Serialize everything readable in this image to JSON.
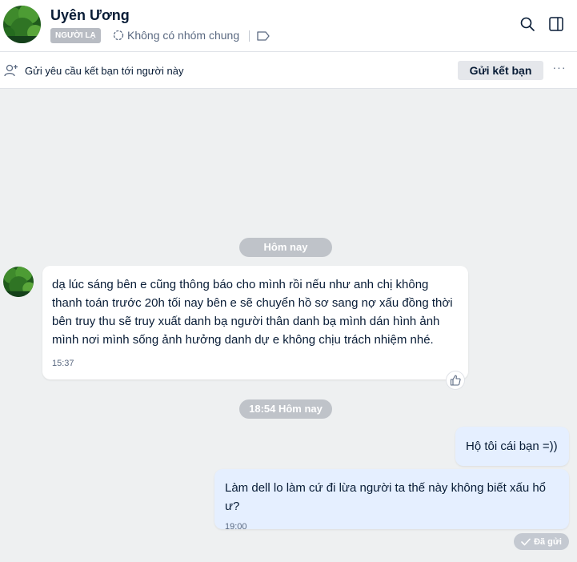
{
  "header": {
    "name": "Uyên Ương",
    "badge": "NGƯỜI LẠ",
    "common_groups": "Không có nhóm chung"
  },
  "friend_bar": {
    "text": "Gửi yêu cầu kết bạn tới người này",
    "button": "Gửi kết bạn",
    "more": "···"
  },
  "chat": {
    "date_separators": [
      "Hôm nay",
      "18:54 Hôm nay"
    ],
    "messages": [
      {
        "direction": "incoming",
        "text": "dạ lúc sáng bên e cũng thông báo cho mình rồi nếu như anh chị không thanh toán trước 20h tối nay bên e sẽ chuyển hồ sơ sang nợ xấu đồng thời bên truy thu sẽ truy xuất danh bạ người thân danh bạ mình dán hình ảnh mình nơi mình sống ảnh hưởng danh dự e không chịu trách nhiệm nhé.",
        "time": "15:37"
      },
      {
        "direction": "outgoing",
        "text": "Hộ tôi cái bạn =))"
      },
      {
        "direction": "outgoing",
        "text": "Làm dell lo làm cứ đi lừa người ta thế này không biết xấu hổ ư?",
        "time": "19:00"
      }
    ],
    "status": "Đã gửi"
  },
  "icons": {
    "header_search": "search-icon",
    "header_panel": "sidebar-toggle-icon",
    "add_friend": "add-user-icon",
    "groups": "group-circle-icon",
    "tag": "tag-icon",
    "like": "thumbs-up-icon",
    "sent": "check-icon"
  },
  "colors": {
    "accent": "#005ae0",
    "outgoing_bubble": "#e5efff",
    "background": "#eef0f1"
  }
}
